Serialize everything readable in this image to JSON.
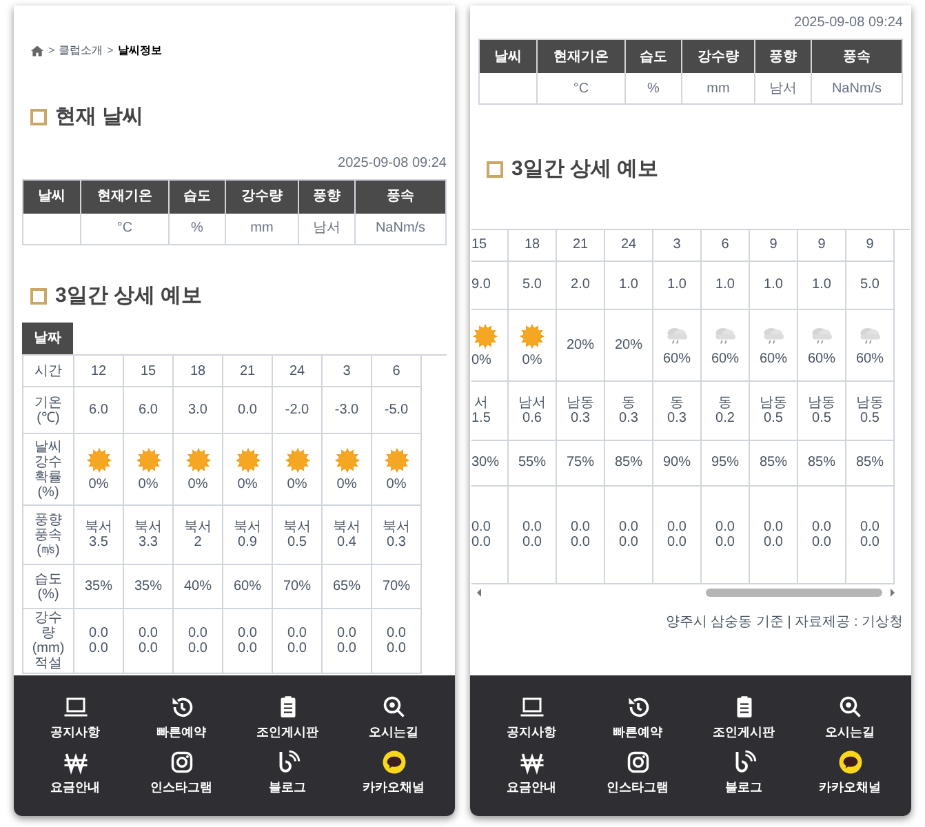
{
  "screens": [
    {
      "breadcrumb": {
        "separator": ">",
        "items": [
          "클럽소개",
          "날씨정보"
        ]
      },
      "current": {
        "title": "현재 날씨",
        "timestamp": "2025-09-08 09:24",
        "columns": [
          {
            "header": "날씨"
          },
          {
            "header": "현재기온",
            "value": "°C"
          },
          {
            "header": "습도",
            "value": "%"
          },
          {
            "header": "강수량",
            "value": "mm"
          },
          {
            "header": "풍향",
            "value": "남서"
          },
          {
            "header": "풍속",
            "value": "NaNm/s"
          }
        ]
      },
      "forecast": {
        "title": "3일간 상세 예보",
        "date_header": "날짜",
        "scrolled": false,
        "row_headers": [
          "시간",
          "기온\n(℃)",
          "날씨\n강수\n확률\n(%)",
          "풍향\n풍속\n(㎧)",
          "습도\n(%)",
          "강수\n량\n(mm)\n적설"
        ],
        "columns": [
          {
            "time": "12",
            "temp": "6.0",
            "kind": "sunny",
            "pop": "0%",
            "wind_dir": "북서",
            "wind_speed": "3.5",
            "humidity": "35%",
            "precip": "0.0",
            "snow": "0.0"
          },
          {
            "time": "15",
            "temp": "6.0",
            "kind": "sunny",
            "pop": "0%",
            "wind_dir": "북서",
            "wind_speed": "3.3",
            "humidity": "35%",
            "precip": "0.0",
            "snow": "0.0"
          },
          {
            "time": "18",
            "temp": "3.0",
            "kind": "sunny",
            "pop": "0%",
            "wind_dir": "북서",
            "wind_speed": "2",
            "humidity": "40%",
            "precip": "0.0",
            "snow": "0.0"
          },
          {
            "time": "21",
            "temp": "0.0",
            "kind": "sunny",
            "pop": "0%",
            "wind_dir": "북서",
            "wind_speed": "0.9",
            "humidity": "60%",
            "precip": "0.0",
            "snow": "0.0"
          },
          {
            "time": "24",
            "temp": "-2.0",
            "kind": "sunny",
            "pop": "0%",
            "wind_dir": "북서",
            "wind_speed": "0.5",
            "humidity": "70%",
            "precip": "0.0",
            "snow": "0.0"
          },
          {
            "time": "3",
            "temp": "-3.0",
            "kind": "sunny",
            "pop": "0%",
            "wind_dir": "북서",
            "wind_speed": "0.4",
            "humidity": "65%",
            "precip": "0.0",
            "snow": "0.0"
          },
          {
            "time": "6",
            "temp": "-5.0",
            "kind": "sunny",
            "pop": "0%",
            "wind_dir": "북서",
            "wind_speed": "0.3",
            "humidity": "70%",
            "precip": "0.0",
            "snow": "0.0"
          }
        ]
      },
      "nav": [
        "공지사항",
        "빠른예약",
        "조인게시판",
        "오시는길",
        "요금안내",
        "인스타그램",
        "블로그",
        "카카오채널"
      ]
    },
    {
      "current": {
        "timestamp": "2025-09-08 09:24",
        "columns": [
          {
            "header": "날씨"
          },
          {
            "header": "현재기온",
            "value": "°C"
          },
          {
            "header": "습도",
            "value": "%"
          },
          {
            "header": "강수량",
            "value": "mm"
          },
          {
            "header": "풍향",
            "value": "남서"
          },
          {
            "header": "풍속",
            "value": "NaNm/s"
          }
        ]
      },
      "forecast": {
        "title": "3일간 상세 예보",
        "scrolled": true,
        "columns": [
          {
            "time": "15",
            "temp": "9.0",
            "kind": "sunny",
            "pop": "0%",
            "wind_dir": "서",
            "wind_speed": "1.5",
            "humidity": "30%",
            "precip": "0.0",
            "snow": "0.0"
          },
          {
            "time": "18",
            "temp": "5.0",
            "kind": "sunny",
            "pop": "0%",
            "wind_dir": "남서",
            "wind_speed": "0.6",
            "humidity": "55%",
            "precip": "0.0",
            "snow": "0.0"
          },
          {
            "time": "21",
            "temp": "2.0",
            "kind": "plain",
            "pop": "20%",
            "wind_dir": "남동",
            "wind_speed": "0.3",
            "humidity": "75%",
            "precip": "0.0",
            "snow": "0.0"
          },
          {
            "time": "24",
            "temp": "1.0",
            "kind": "plain",
            "pop": "20%",
            "wind_dir": "동",
            "wind_speed": "0.3",
            "humidity": "85%",
            "precip": "0.0",
            "snow": "0.0"
          },
          {
            "time": "3",
            "temp": "1.0",
            "kind": "rain_cloud",
            "pop": "60%",
            "wind_dir": "동",
            "wind_speed": "0.3",
            "humidity": "90%",
            "precip": "0.0",
            "snow": "0.0"
          },
          {
            "time": "6",
            "temp": "1.0",
            "kind": "rain_cloud",
            "pop": "60%",
            "wind_dir": "동",
            "wind_speed": "0.2",
            "humidity": "95%",
            "precip": "0.0",
            "snow": "0.0"
          },
          {
            "time": "9",
            "temp": "1.0",
            "kind": "rain_cloud",
            "pop": "60%",
            "wind_dir": "남동",
            "wind_speed": "0.5",
            "humidity": "85%",
            "precip": "0.0",
            "snow": "0.0"
          },
          {
            "time": "9",
            "temp": "1.0",
            "kind": "rain_cloud",
            "pop": "60%",
            "wind_dir": "남동",
            "wind_speed": "0.5",
            "humidity": "85%",
            "precip": "0.0",
            "snow": "0.0"
          },
          {
            "time": "9",
            "temp": "5.0",
            "kind": "rain_cloud",
            "pop": "60%",
            "wind_dir": "남동",
            "wind_speed": "0.5",
            "humidity": "85%",
            "precip": "0.0",
            "snow": "0.0"
          }
        ]
      },
      "source_note": "양주시 삼숭동 기준 | 자료제공 : 기상청",
      "nav": [
        "공지사항",
        "빠른예약",
        "조인게시판",
        "오시는길",
        "요금안내",
        "인스타그램",
        "블로그",
        "카카오채널"
      ]
    }
  ]
}
